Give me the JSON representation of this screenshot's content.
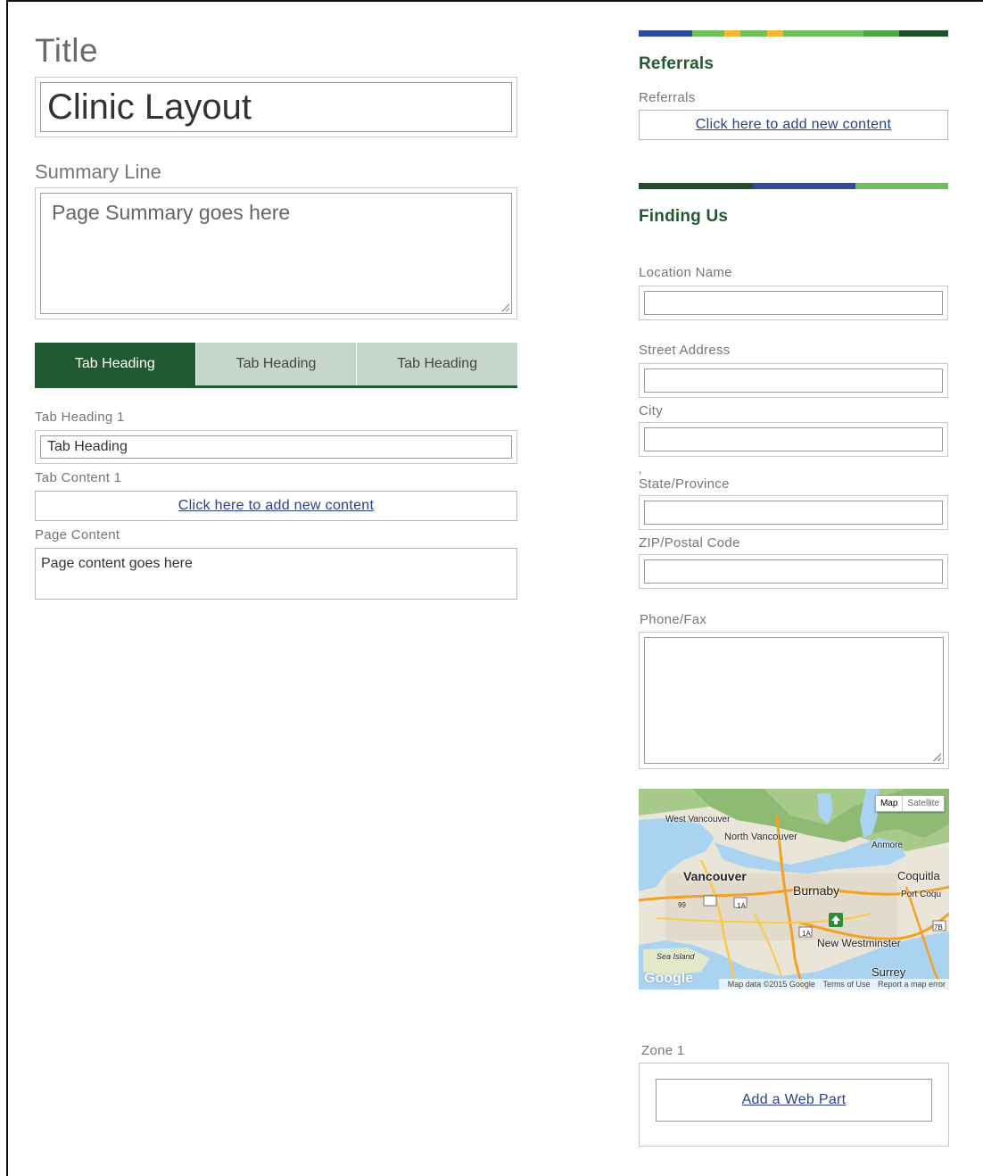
{
  "title_label": "Title",
  "title_value": "Clinic Layout",
  "summary_label": "Summary Line",
  "summary_placeholder": "Page Summary goes here",
  "tabs": [
    {
      "label": "Tab Heading"
    },
    {
      "label": "Tab Heading"
    },
    {
      "label": "Tab Heading"
    }
  ],
  "tab_heading_1_label": "Tab Heading 1",
  "tab_heading_1_value": "Tab Heading",
  "tab_content_1_label": "Tab Content 1",
  "add_content_link": "Click here to add new content",
  "page_content_label": "Page Content",
  "page_content_value": "Page content goes here",
  "referrals": {
    "title": "Referrals",
    "field_label": "Referrals",
    "add_content_link": "Click here to add new content"
  },
  "finding_us": {
    "title": "Finding Us",
    "location_name_label": "Location Name",
    "street_address_label": "Street Address",
    "city_label": "City",
    "comma": ",",
    "state_label": "State/Province",
    "zip_label": "ZIP/Postal Code",
    "phone_label": "Phone/Fax"
  },
  "map": {
    "type_map": "Map",
    "type_satellite": "Satellite",
    "places": {
      "west_vancouver": "West Vancouver",
      "north_vancouver": "North Vancouver",
      "vancouver": "Vancouver",
      "burnaby": "Burnaby",
      "anmore": "Anmore",
      "coquitlam": "Coquitla",
      "port_coquitlam": "Port Coqu",
      "new_westminster": "New Westminster",
      "surrey": "Surrey",
      "sea_island": "Sea Island"
    },
    "shields": {
      "hwy99": "99",
      "hwy1a_a": "1A",
      "hwy1a_b": "1A",
      "hwy7b": "7B"
    },
    "google": "Google",
    "attribution": "Map data ©2015 Google",
    "terms": "Terms of Use",
    "report": "Report a map error"
  },
  "zone": {
    "label": "Zone 1",
    "add_web_part": "Add a Web Part"
  },
  "colors": {
    "accent_green": "#215a30",
    "tab_inactive": "#c6d6ca",
    "link_blue": "#2c3f8a"
  }
}
